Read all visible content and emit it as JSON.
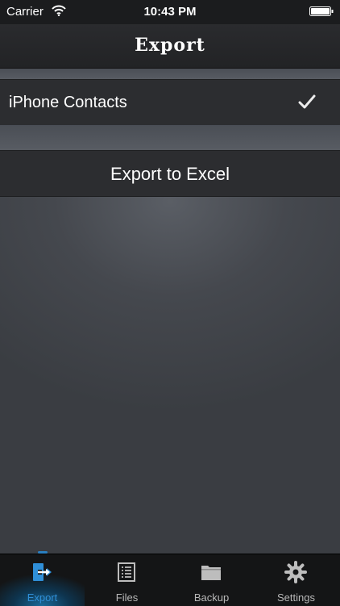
{
  "status_bar": {
    "carrier": "Carrier",
    "time": "10:43 PM"
  },
  "nav": {
    "title": "Export"
  },
  "list": {
    "source_item": {
      "label": "iPhone Contacts",
      "selected": true
    },
    "export_button": {
      "label": "Export to Excel"
    }
  },
  "tab_bar": {
    "active": "Export",
    "accent_color": "#2f8fd8",
    "tabs": [
      {
        "label": "Export",
        "icon": "export-icon"
      },
      {
        "label": "Files",
        "icon": "list-icon"
      },
      {
        "label": "Backup",
        "icon": "folder-icon"
      },
      {
        "label": "Settings",
        "icon": "gear-icon"
      }
    ]
  }
}
